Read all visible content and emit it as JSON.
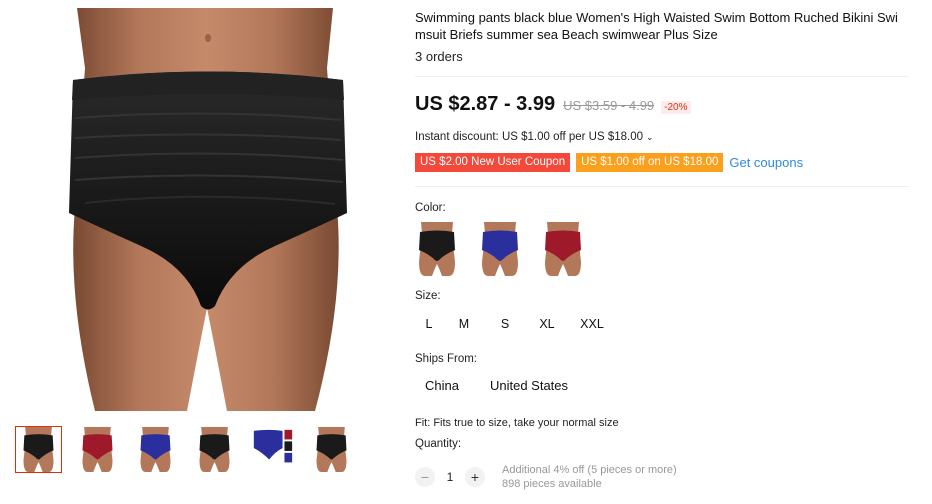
{
  "product": {
    "title": "Swimming pants black blue Women's High Waisted Swim Bottom Ruched Bikini Swimsuit Briefs summer sea Beach swimwear Plus Size",
    "title_line1": "Swimming pants black blue Women's High Waisted Swim Bottom Ruched Bikini Swi",
    "title_line2": "msuit Briefs summer sea Beach swimwear Plus Size",
    "orders": "3 orders"
  },
  "price": {
    "current": "US $2.87 - 3.99",
    "original": "US $3.59 - 4.99",
    "discount": "-20%"
  },
  "instant_discount": {
    "text": "Instant discount: US $1.00 off per US $18.00",
    "chevron": "⌄"
  },
  "coupons": {
    "new_user": "US $2.00 New User Coupon",
    "store": "US $1.00 off on US $18.00",
    "get_label": "Get coupons"
  },
  "color": {
    "label": "Color:",
    "options": [
      "black",
      "blue",
      "red"
    ],
    "colors": {
      "black": "#1a1a1a",
      "blue": "#2b2f9e",
      "red": "#9e1a2a"
    }
  },
  "size": {
    "label": "Size:",
    "options": [
      "L",
      "M",
      "S",
      "XL",
      "XXL"
    ]
  },
  "ships": {
    "label": "Ships From:",
    "options": [
      "China",
      "United States"
    ]
  },
  "fit": "Fit: Fits true to size, take your normal size",
  "quantity": {
    "label": "Quantity:",
    "minus": "−",
    "value": "1",
    "plus": "+",
    "note_line1": "Additional 4% off (5 pieces or more)",
    "note_line2": "898 pieces available"
  },
  "gallery": {
    "selected_index": 0,
    "thumbs": [
      "black",
      "red",
      "blue",
      "black",
      "blue-multi",
      "black"
    ]
  },
  "theme": {
    "accent": "#e62e04",
    "link": "#2e8ae2",
    "coupon_red": "#f4493a",
    "coupon_orange": "#fba01c"
  }
}
